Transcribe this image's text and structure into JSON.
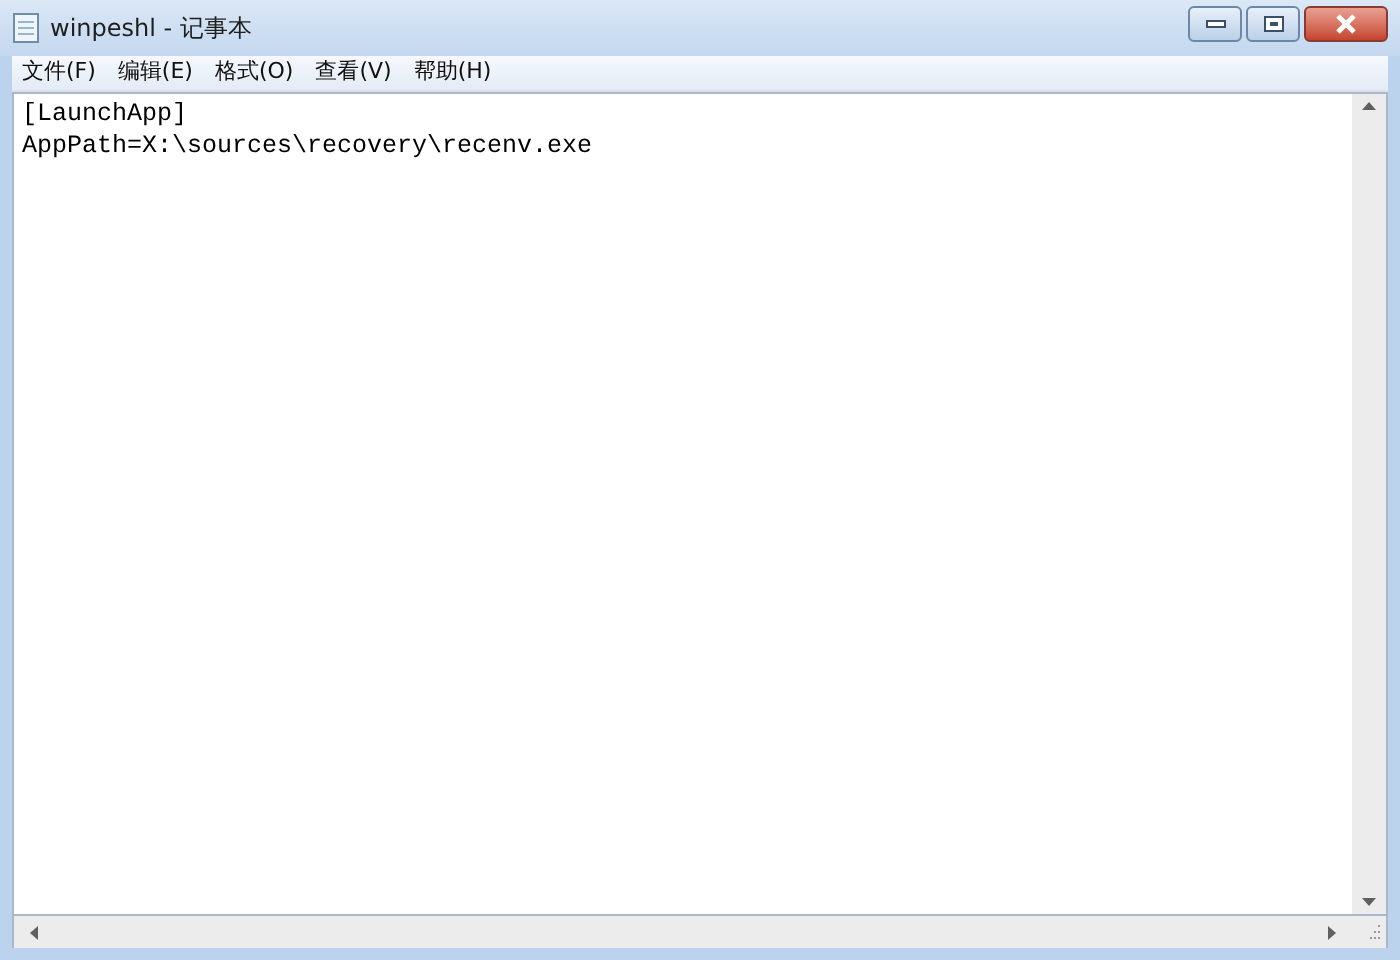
{
  "window": {
    "title": "winpeshl - 记事本"
  },
  "menu": [
    "文件(F)",
    "编辑(E)",
    "格式(O)",
    "查看(V)",
    "帮助(H)"
  ],
  "editor": {
    "lines": [
      "[LaunchApp]",
      "AppPath=X:\\sources\\recovery\\recenv.exe"
    ]
  }
}
